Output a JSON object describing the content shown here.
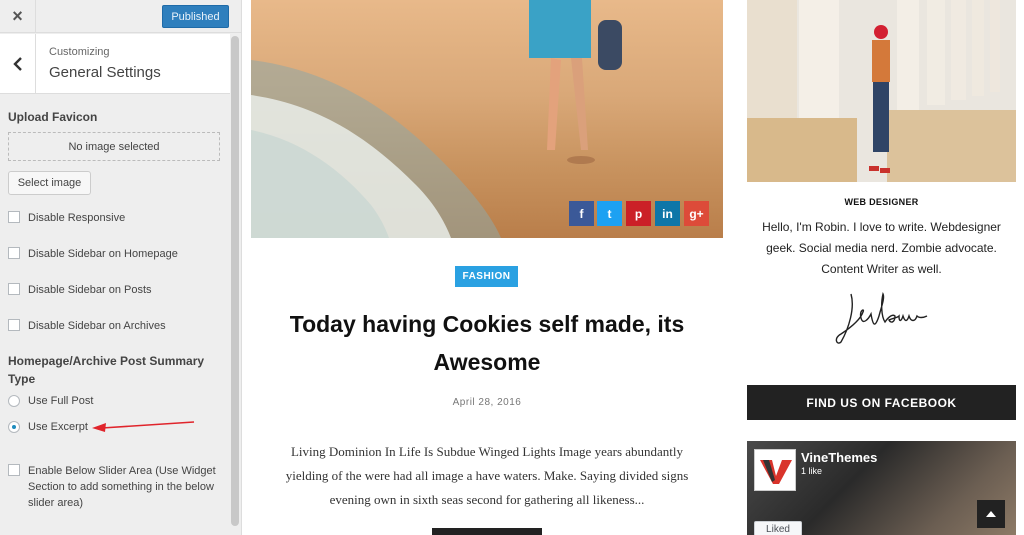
{
  "customizer": {
    "close_label": "×",
    "publish_label": "Published",
    "breadcrumb": "Customizing",
    "section_title": "General Settings",
    "favicon": {
      "title": "Upload Favicon",
      "placeholder": "No image selected",
      "button_label": "Select image"
    },
    "checkboxes": [
      {
        "label": "Disable Responsive",
        "checked": false
      },
      {
        "label": "Disable Sidebar on Homepage",
        "checked": false
      },
      {
        "label": "Disable Sidebar on Posts",
        "checked": false
      },
      {
        "label": "Disable Sidebar on Archives",
        "checked": false
      }
    ],
    "summary_type": {
      "title": "Homepage/Archive Post Summary Type",
      "options": [
        {
          "label": "Use Full Post",
          "selected": false
        },
        {
          "label": "Use Excerpt",
          "selected": true
        }
      ]
    },
    "slider_area": {
      "label": "Enable Below Slider Area (Use Widget Section to add something in the below slider area)",
      "checked": false
    }
  },
  "post": {
    "category": "FASHION",
    "title": "Today having Cookies self made, its Awesome",
    "date": "April 28, 2016",
    "excerpt": "Living Dominion In Life Is Subdue Winged Lights Image years abundantly yielding of the were had all image a have waters. Make. Saying divided signs evening own in sixth seas second for gathering all likeness...",
    "share": [
      {
        "icon": "facebook-icon",
        "glyph": "f",
        "color": "#3b5998"
      },
      {
        "icon": "twitter-icon",
        "glyph": "t",
        "color": "#1da1f2"
      },
      {
        "icon": "pinterest-icon",
        "glyph": "p",
        "color": "#cb2027"
      },
      {
        "icon": "linkedin-icon",
        "glyph": "in",
        "color": "#0e76a8"
      },
      {
        "icon": "google-plus-icon",
        "glyph": "g+",
        "color": "#dd4b39"
      }
    ]
  },
  "sidebar": {
    "author_role": "WEB DESIGNER",
    "author_bio": "Hello, I'm Robin. I love to write. Webdesigner geek. Social media nerd. Zombie advocate. Content Writer as well.",
    "facebook_heading": "FIND US ON FACEBOOK",
    "facebook_page": {
      "name": "VineThemes",
      "likes": "1 like",
      "liked_label": "Liked"
    }
  },
  "colors": {
    "accent": "#2aa1e2",
    "publish": "#2f7fbd",
    "annotation_arrow": "#e0242b"
  }
}
